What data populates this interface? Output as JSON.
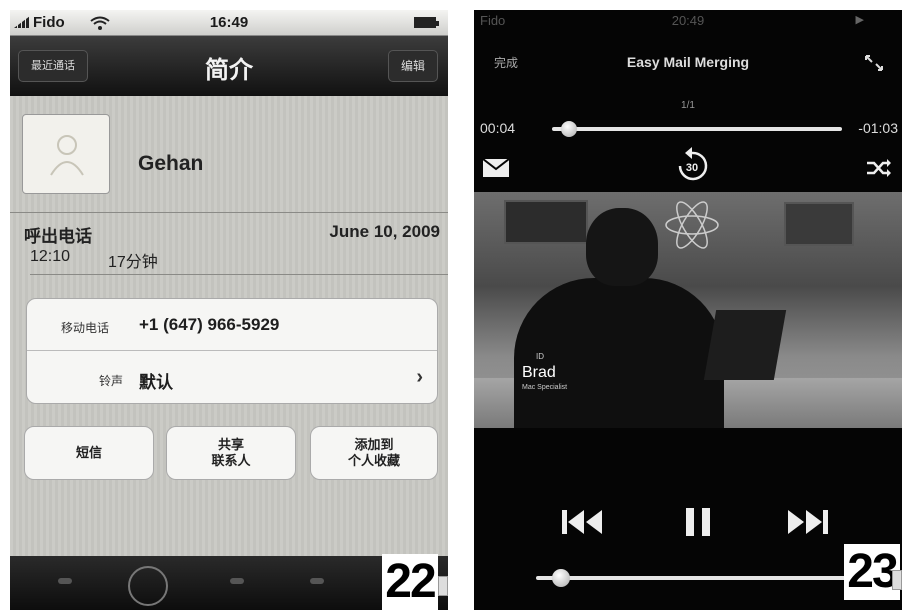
{
  "left_screen": {
    "status_bar": {
      "carrier": "Fido",
      "time": "16:49"
    },
    "nav": {
      "back_label": "最近通话",
      "title": "简介",
      "edit_label": "编辑"
    },
    "contact": {
      "name": "Gehan"
    },
    "call": {
      "type": "呼出电话",
      "date": "June 10, 2009",
      "time": "12:10",
      "duration": "17分钟"
    },
    "details": [
      {
        "label": "移动电话",
        "value": "+1 (647) 966-5929"
      },
      {
        "label": "铃声",
        "value": "默认"
      }
    ],
    "actions": {
      "sms": "短信",
      "share_line1": "共享",
      "share_line2": "联系人",
      "fav_line1": "添加到",
      "fav_line2": "个人收藏"
    },
    "page_number": "22"
  },
  "right_screen": {
    "status_bar": {
      "carrier": "Fido",
      "time": "20:49"
    },
    "header": {
      "done_label": "完成",
      "title": "Easy Mail Merging",
      "count": "1/1"
    },
    "progress": {
      "elapsed": "00:04",
      "remaining": "-01:03",
      "fraction": 0.06
    },
    "video": {
      "caption_name": "Brad",
      "caption_sub": "Mac Specialist",
      "caption_mark": "ID"
    },
    "volume": {
      "fraction": 0.08
    },
    "icons": [
      "mail-icon",
      "replay-30-icon",
      "shuffle-icon",
      "expand-icon",
      "previous-icon",
      "pause-icon",
      "next-icon"
    ],
    "page_number": "23"
  }
}
